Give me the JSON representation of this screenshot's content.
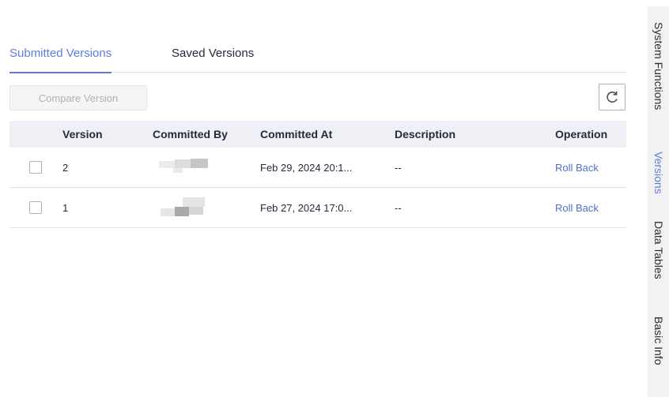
{
  "tabs": [
    {
      "label": "Submitted Versions",
      "active": true
    },
    {
      "label": "Saved Versions",
      "active": false
    }
  ],
  "toolbar": {
    "compare_label": "Compare Version",
    "refresh_icon": "refresh-icon"
  },
  "table": {
    "columns": [
      "Version",
      "Committed By",
      "Committed At",
      "Description",
      "Operation"
    ],
    "rows": [
      {
        "version": "2",
        "committed_at": "Feb 29, 2024 20:1...",
        "description": "--",
        "operation": "Roll Back"
      },
      {
        "version": "1",
        "committed_at": "Feb 27, 2024 17:0...",
        "description": "--",
        "operation": "Roll Back"
      }
    ]
  },
  "sidebar": {
    "items": [
      {
        "label": "System Functions",
        "active": false
      },
      {
        "label": "Versions",
        "active": true
      },
      {
        "label": "Data Tables",
        "active": false
      },
      {
        "label": "Basic Info",
        "active": false
      }
    ]
  },
  "colors": {
    "accent": "#5e7ce0",
    "link": "#526ecc",
    "header_bg": "#eef0f5",
    "sidebar_bg": "#f2f2f3"
  }
}
